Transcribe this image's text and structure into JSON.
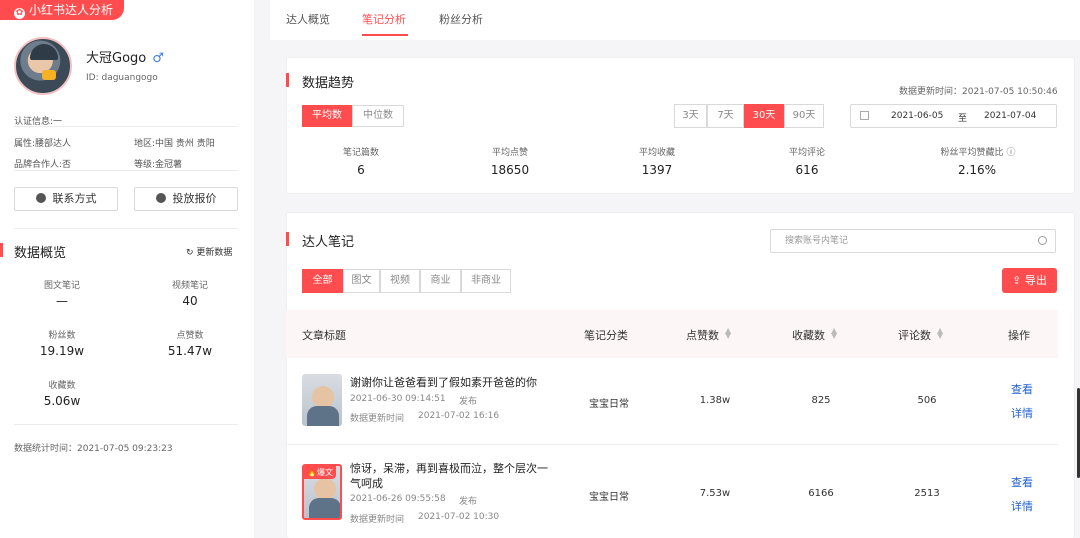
{
  "badge": {
    "label": "小红书达人分析"
  },
  "profile": {
    "name": "大冠Gogo",
    "gender": "♂",
    "id_text": "ID: daguangogo",
    "verify": "认证信息:一",
    "attr": "属性:腰部达人",
    "region": "地区:中国 贵州 贵阳",
    "brand": "品牌合作人:否",
    "level": "等级:金冠薯"
  },
  "buttons": {
    "contact": "联系方式",
    "quote": "投放报价"
  },
  "overview": {
    "title": "数据概览",
    "refresh": "更新数据",
    "stats": [
      {
        "label": "图文笔记",
        "value": "—"
      },
      {
        "label": "视频笔记",
        "value": "40"
      },
      {
        "label": "粉丝数",
        "value": "19.19w"
      },
      {
        "label": "点赞数",
        "value": "51.47w"
      },
      {
        "label": "收藏数",
        "value": "5.06w"
      }
    ],
    "stat_time": "数据统计时间：2021-07-05 09:23:23"
  },
  "tabs": [
    {
      "label": "达人概览"
    },
    {
      "label": "笔记分析"
    },
    {
      "label": "粉丝分析"
    }
  ],
  "trend": {
    "title": "数据趋势",
    "update_time": "数据更新时间：2021-07-05 10:50:46",
    "modes": [
      "平均数",
      "中位数"
    ],
    "ranges": [
      "3天",
      "7天",
      "30天",
      "90天"
    ],
    "date_from": "2021-06-05",
    "date_sep": "至",
    "date_to": "2021-07-04",
    "metrics": [
      {
        "label": "笔记篇数",
        "value": "6"
      },
      {
        "label": "平均点赞",
        "value": "18650"
      },
      {
        "label": "平均收藏",
        "value": "1397"
      },
      {
        "label": "平均评论",
        "value": "616"
      },
      {
        "label": "粉丝平均赞藏比",
        "value": "2.16%"
      }
    ]
  },
  "notes": {
    "title": "达人笔记",
    "search_placeholder": "搜索账号内笔记",
    "filters": [
      "全部",
      "图文",
      "视频",
      "商业",
      "非商业"
    ],
    "export": "导出",
    "columns": [
      "文章标题",
      "笔记分类",
      "点赞数",
      "收藏数",
      "评论数",
      "操作"
    ],
    "rows": [
      {
        "title": "谢谢你让爸爸看到了假如素开爸爸的你",
        "date": "2021-06-30 09:14:51",
        "publish": "发布",
        "update_label": "数据更新时间",
        "update_time": "2021-07-02 16:16",
        "category": "宝宝日常",
        "likes": "1.38w",
        "favs": "825",
        "comments": "506",
        "action1": "查看",
        "action2": "详情"
      },
      {
        "title": "惊讶，呆滞，再到喜极而泣，整个层次一气呵成",
        "hot": "爆文",
        "date": "2021-06-26 09:55:58",
        "publish": "发布",
        "update_label": "数据更新时间",
        "update_time": "2021-07-02 10:30",
        "category": "宝宝日常",
        "likes": "7.53w",
        "favs": "6166",
        "comments": "2513",
        "action1": "查看",
        "action2": "详情"
      }
    ]
  }
}
